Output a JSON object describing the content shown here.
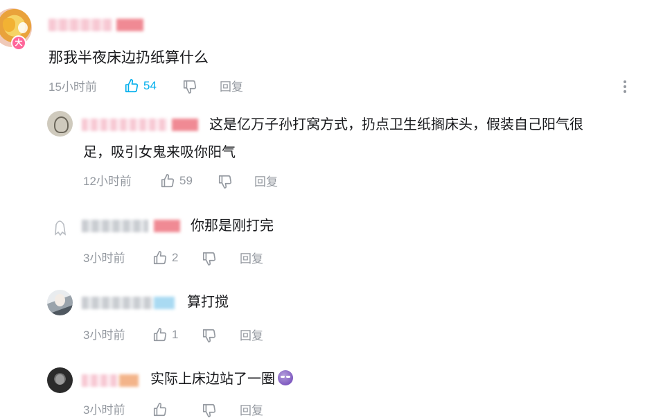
{
  "main_comment": {
    "text": "那我半夜床边扔纸算什么",
    "time": "15小时前",
    "likes": "54",
    "reply_label": "回复",
    "badge": "大",
    "liked": true,
    "accent_color": "#00aeec"
  },
  "replies": [
    {
      "text_line1": "这是亿万子孙打窝方式，扔点卫生纸搁床头，假装自己阳气很",
      "text_line2": "足，吸引女鬼来吸你阳气",
      "time": "12小时前",
      "likes": "59",
      "reply_label": "回复"
    },
    {
      "text": "你那是刚打完",
      "time": "3小时前",
      "likes": "2",
      "reply_label": "回复"
    },
    {
      "text": "算打搅",
      "time": "3小时前",
      "likes": "1",
      "reply_label": "回复"
    },
    {
      "text": "实际上床边站了一圈",
      "emoji": "purple-face-emoji",
      "time": "3小时前",
      "reply_label": "回复"
    }
  ],
  "icons": {
    "like": "thumbs-up-icon",
    "dislike": "thumbs-down-icon",
    "more": "more-vertical-icon"
  }
}
